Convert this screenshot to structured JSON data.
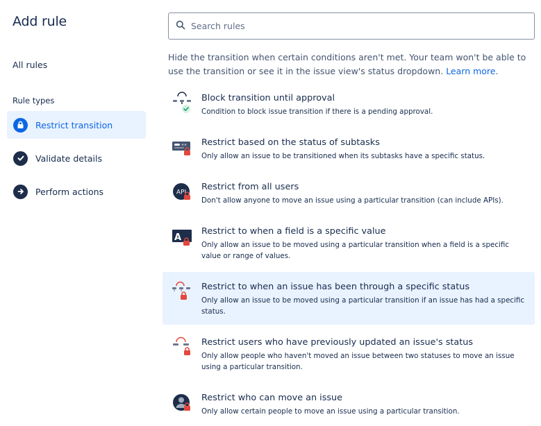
{
  "sidebar": {
    "title": "Add rule",
    "all_rules": "All rules",
    "rule_types_heading": "Rule types",
    "items": [
      {
        "label": "Restrict transition",
        "icon": "lock-icon",
        "selected": true
      },
      {
        "label": "Validate details",
        "icon": "check-circle-icon",
        "selected": false
      },
      {
        "label": "Perform actions",
        "icon": "arrow-right-circle-icon",
        "selected": false
      }
    ]
  },
  "search": {
    "placeholder": "Search rules",
    "value": ""
  },
  "intro": {
    "text": "Hide the transition when certain conditions aren't met. Your team won't be able to use the transition or see it in the issue view's status dropdown.",
    "link": "Learn more",
    "suffix": "."
  },
  "rules": [
    {
      "title": "Block transition until approval",
      "description": "Condition to block issue transition if there is a pending approval.",
      "icon": "approval-icon"
    },
    {
      "title": "Restrict based on the status of subtasks",
      "description": "Only allow an issue to be transitioned when its subtasks have a specific status.",
      "icon": "subtasks-lock-icon"
    },
    {
      "title": "Restrict from all users",
      "description": "Don't allow anyone to move an issue using a particular transition (can include APIs).",
      "icon": "api-lock-icon"
    },
    {
      "title": "Restrict to when a field is a specific value",
      "description": "Only allow an issue to be moved using a particular transition when a field is a specific value or range of values.",
      "icon": "field-lock-icon"
    },
    {
      "title": "Restrict to when an issue has been through a specific status",
      "description": "Only allow an issue to be moved using a particular transition if an issue has had a specific status.",
      "icon": "status-history-lock-icon",
      "highlighted": true
    },
    {
      "title": "Restrict users who have previously updated an issue's status",
      "description": "Only allow people who haven't moved an issue between two statuses to move an issue using a particular transition.",
      "icon": "user-status-lock-icon"
    },
    {
      "title": "Restrict who can move an issue",
      "description": "Only allow certain people to move an issue using a particular transition.",
      "icon": "user-lock-icon"
    }
  ],
  "colors": {
    "accent": "#0c66e4",
    "selected_bg": "#e9f2ff",
    "text": "#172b4d",
    "subtle_text": "#44546f",
    "lock_red": "#e2483d",
    "approve_green": "#22a06b",
    "icon_dark": "#1d2d4a"
  }
}
